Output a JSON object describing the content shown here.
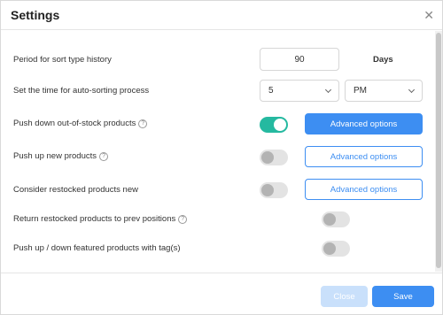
{
  "header": {
    "title": "Settings",
    "close_icon": "close-icon"
  },
  "settings": {
    "sort_history": {
      "label": "Period for sort type history",
      "value": "90",
      "unit": "Days"
    },
    "auto_sort_time": {
      "label": "Set the time for auto-sorting process",
      "hour": "5",
      "period": "PM"
    },
    "push_down_oos": {
      "label": "Push down out-of-stock products",
      "has_help": true,
      "enabled": true,
      "button": "Advanced options"
    },
    "push_up_new": {
      "label": "Push up new products",
      "has_help": true,
      "enabled": false,
      "button": "Advanced options"
    },
    "restocked_new": {
      "label": "Consider restocked products new",
      "has_help": false,
      "enabled": false,
      "button": "Advanced options"
    },
    "return_restocked": {
      "label": "Return restocked products to prev positions",
      "has_help": true,
      "enabled": false
    },
    "featured_tags": {
      "label": "Push up / down featured products with tag(s)",
      "has_help": false,
      "enabled": false
    }
  },
  "help_glyph": "?",
  "footer": {
    "close_label": "Close",
    "save_label": "Save"
  },
  "colors": {
    "accent": "#3d8ef2",
    "toggle_on": "#25b9a0",
    "toggle_off": "#e3e3e3"
  }
}
